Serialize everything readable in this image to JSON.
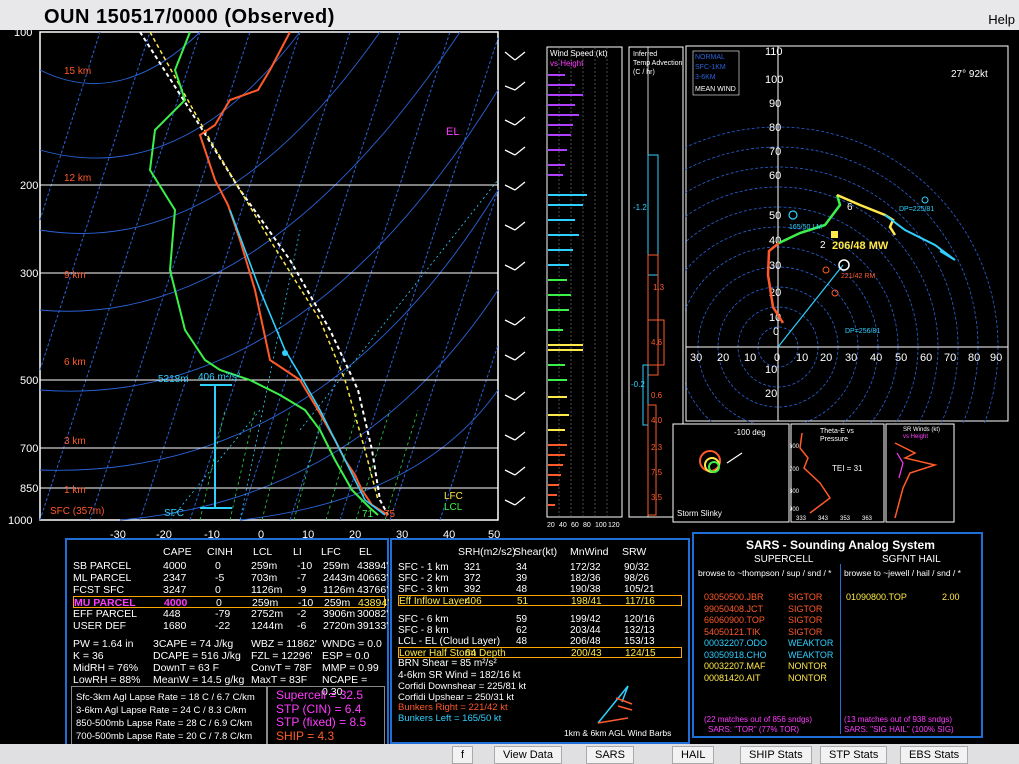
{
  "window": {
    "title": "OUN   150517/0000  (Observed)",
    "help": "Help"
  },
  "skewt": {
    "pressure_labels": [
      "100",
      "200",
      "300",
      "500",
      "700",
      "850",
      "1000"
    ],
    "height_labels": [
      "15 km",
      "12 km",
      "9 km",
      "6 km",
      "3 km",
      "1 km",
      "SFC (357m)"
    ],
    "temp_axis": [
      "-30",
      "-20",
      "-10",
      "0",
      "10",
      "20",
      "30",
      "40",
      "50"
    ],
    "el_label": "EL",
    "lfc_label": "LFC",
    "lcl_label": "LCL",
    "sfc_label": "SFC",
    "t_sfc": "75",
    "td_sfc": "71",
    "level_5218": "5218m",
    "wind_406": "406 m²/s²"
  },
  "hodo_side": {
    "wind_speed_title": "Wind Speed (kt)",
    "wind_speed_sub": "vs Height",
    "wind_axis": [
      "20",
      "40",
      "60",
      "80",
      "100",
      "120"
    ],
    "inferred_title": "Inferred",
    "temp_adv_title": "Temp Advection",
    "temp_adv_units": "(C / hr)",
    "adv_values": [
      "-1.2",
      "1.3",
      "4.6",
      "-0.2",
      "0.6",
      "4.0",
      "2.3",
      "7.5",
      "3.5"
    ]
  },
  "hodograph": {
    "legend": [
      "NORMAL",
      "SFC-1KM",
      "3-6KM",
      "MEAN WIND"
    ],
    "corner": "27° 92kt",
    "y_labels": [
      "110",
      "100",
      "90",
      "80",
      "70",
      "60",
      "50",
      "40",
      "30",
      "20",
      "10",
      "0"
    ],
    "x_labels": [
      "30",
      "20",
      "10",
      "0",
      "10",
      "20",
      "30",
      "40",
      "50",
      "60",
      "70",
      "80",
      "90"
    ],
    "neg_labels": [
      "10",
      "20",
      "30",
      "40",
      "50",
      "60",
      "70",
      "80",
      "90"
    ],
    "dp_label": "DP=225/81",
    "dp2_label": "DP=256/81",
    "lm_label": "165/50 LM",
    "rm_label": "221/42 RM",
    "mw_label": "206/48 MW",
    "num2": "2",
    "num6": "6"
  },
  "mini": {
    "slinky_title": "Storm Slinky",
    "slinky_deg": "-100 deg",
    "thetae_title": "Theta-E vs",
    "thetae_sub": "Pressure",
    "tei": "TEI = 31",
    "thetae_y": [
      "600",
      "700",
      "800",
      "900"
    ],
    "thetae_x": [
      "333",
      "343",
      "353",
      "363"
    ],
    "srw_title": "SR Winds (kt)",
    "srw_sub": "vs Height"
  },
  "parcels": {
    "headers": [
      "CAPE",
      "CINH",
      "LCL",
      "LI",
      "LFC",
      "EL"
    ],
    "rows": [
      {
        "name": "SB PARCEL",
        "cape": "4000",
        "cinh": "0",
        "lcl": "259m",
        "li": "-10",
        "lfc": "259m",
        "el": "43894'"
      },
      {
        "name": "ML PARCEL",
        "cape": "2347",
        "cinh": "-5",
        "lcl": "703m",
        "li": "-7",
        "lfc": "2443m",
        "el": "40663'"
      },
      {
        "name": "FCST SFC",
        "cape": "3247",
        "cinh": "0",
        "lcl": "1126m",
        "li": "-9",
        "lfc": "1126m",
        "el": "43766'"
      },
      {
        "name": "MU PARCEL",
        "cape": "4000",
        "cinh": "0",
        "lcl": "259m",
        "li": "-10",
        "lfc": "259m",
        "el": "43894'"
      },
      {
        "name": "EFF PARCEL",
        "cape": "448",
        "cinh": "-79",
        "lcl": "2752m",
        "li": "-2",
        "lfc": "3906m",
        "el": "30082'"
      },
      {
        "name": "USER DEF",
        "cape": "1680",
        "cinh": "-22",
        "lcl": "1244m",
        "li": "-6",
        "lfc": "2720m",
        "el": "39133'"
      }
    ],
    "misc_col1": [
      "PW = 1.64 in",
      "K = 36",
      "MidRH = 76%",
      "LowRH = 88%"
    ],
    "misc_col2": [
      "3CAPE = 74 J/kg",
      "DCAPE = 516 J/kg",
      "DownT = 63 F",
      "MeanW = 14.5 g/kg"
    ],
    "misc_col3": [
      "WBZ = 11862'",
      "FZL = 12296'",
      "ConvT = 78F",
      "MaxT = 83F"
    ],
    "misc_col4": [
      "WNDG = 0.0",
      "ESP = 0.0",
      "MMP = 0.99",
      "NCAPE = 0.30"
    ],
    "lapse": [
      "Sfc-3km Agl Lapse Rate = 18 C / 6.7 C/km",
      "3-6km Agl Lapse Rate = 24 C / 8.3 C/km",
      "850-500mb Lapse Rate = 28 C / 6.9 C/km",
      "700-500mb Lapse Rate = 20 C / 7.8 C/km"
    ],
    "indices": [
      "Supercell = 32.5",
      "STP (CIN) = 6.4",
      "STP (fixed) = 8.5",
      "SHIP = 4.3"
    ]
  },
  "kinematics": {
    "headers": [
      "SRH(m2/s2)",
      "Shear(kt)",
      "MnWind",
      "SRW"
    ],
    "rows": [
      {
        "name": "SFC - 1 km",
        "srh": "321",
        "shear": "34",
        "mn": "172/32",
        "srw": "90/32"
      },
      {
        "name": "SFC - 2 km",
        "srh": "372",
        "shear": "39",
        "mn": "182/36",
        "srw": "98/26"
      },
      {
        "name": "SFC - 3 km",
        "srh": "392",
        "shear": "48",
        "mn": "190/38",
        "srw": "105/21"
      },
      {
        "name": "Eff Inflow Layer",
        "srh": "406",
        "shear": "51",
        "mn": "198/41",
        "srw": "117/16"
      },
      {
        "name": "SFC - 6 km",
        "srh": "",
        "shear": "59",
        "mn": "199/42",
        "srw": "120/16"
      },
      {
        "name": "SFC - 8 km",
        "srh": "",
        "shear": "62",
        "mn": "203/44",
        "srw": "132/13"
      },
      {
        "name": "LCL - EL (Cloud Layer)",
        "srh": "",
        "shear": "48",
        "mn": "206/48",
        "srw": "153/13"
      },
      {
        "name": "Lower Half Storm Depth",
        "srh": "64",
        "shear": "",
        "mn": "200/43",
        "srw": "124/15"
      }
    ],
    "brn": "BRN Shear = 85 m²/s²",
    "srw46": "4-6km SR Wind = 182/16 kt",
    "corfidi_dn_label": "Corfidi Downshear =",
    "corfidi_dn": "225/81 kt",
    "corfidi_up_label": "Corfidi Upshear =",
    "corfidi_up": "250/31 kt",
    "bunkers_r_label": "Bunkers Right =",
    "bunkers_r": "221/42 kt",
    "bunkers_l_label": "Bunkers Left =",
    "bunkers_l": "165/50 kt",
    "barbs_label": "1km & 6km AGL Wind Barbs"
  },
  "sars": {
    "title": "SARS - Sounding Analog System",
    "supercell_title": "SUPERCELL",
    "hail_title": "SGFNT HAIL",
    "browse_sup": "browse to ~thompson / sup / snd / *",
    "browse_hail": "browse to ~jewell / hail / snd / *",
    "sup_matches": [
      {
        "id": "03050500.JBR",
        "cat": "SIGTOR"
      },
      {
        "id": "99050408.JCT",
        "cat": "SIGTOR"
      },
      {
        "id": "66060900.TOP",
        "cat": "SIGTOR"
      },
      {
        "id": "54050121.TIK",
        "cat": "SIGTOR"
      },
      {
        "id": "00032207.ODO",
        "cat": "WEAKTOR"
      },
      {
        "id": "03050918.CHO",
        "cat": "WEAKTOR"
      },
      {
        "id": "00032207.MAF",
        "cat": "NONTOR"
      },
      {
        "id": "00081420.AIT",
        "cat": "NONTOR"
      }
    ],
    "hail_matches": [
      {
        "id": "01090800.TOP",
        "size": "2.00"
      }
    ],
    "sup_summary1": "(22 matches out of 856 sndgs)",
    "sup_summary2": "SARS: \"TOR\" (77% TOR)",
    "hail_summary1": "(13 matches out of 938 sndgs)",
    "hail_summary2": "SARS: \"SIG HAIL\" (100% SIG)"
  },
  "buttons": [
    "f",
    "View Data",
    "SARS",
    "HAIL",
    "SHIP Stats",
    "STP Stats",
    "EBS Stats"
  ],
  "colors": {
    "accent": "#1f6fd6",
    "temp": "#ff5a2a",
    "dewp": "#3cf04a",
    "wetbulb": "#2fd0ff",
    "parcel": "#ffffff",
    "magenta": "#ff3cff",
    "yellow": "#ffe94a"
  }
}
